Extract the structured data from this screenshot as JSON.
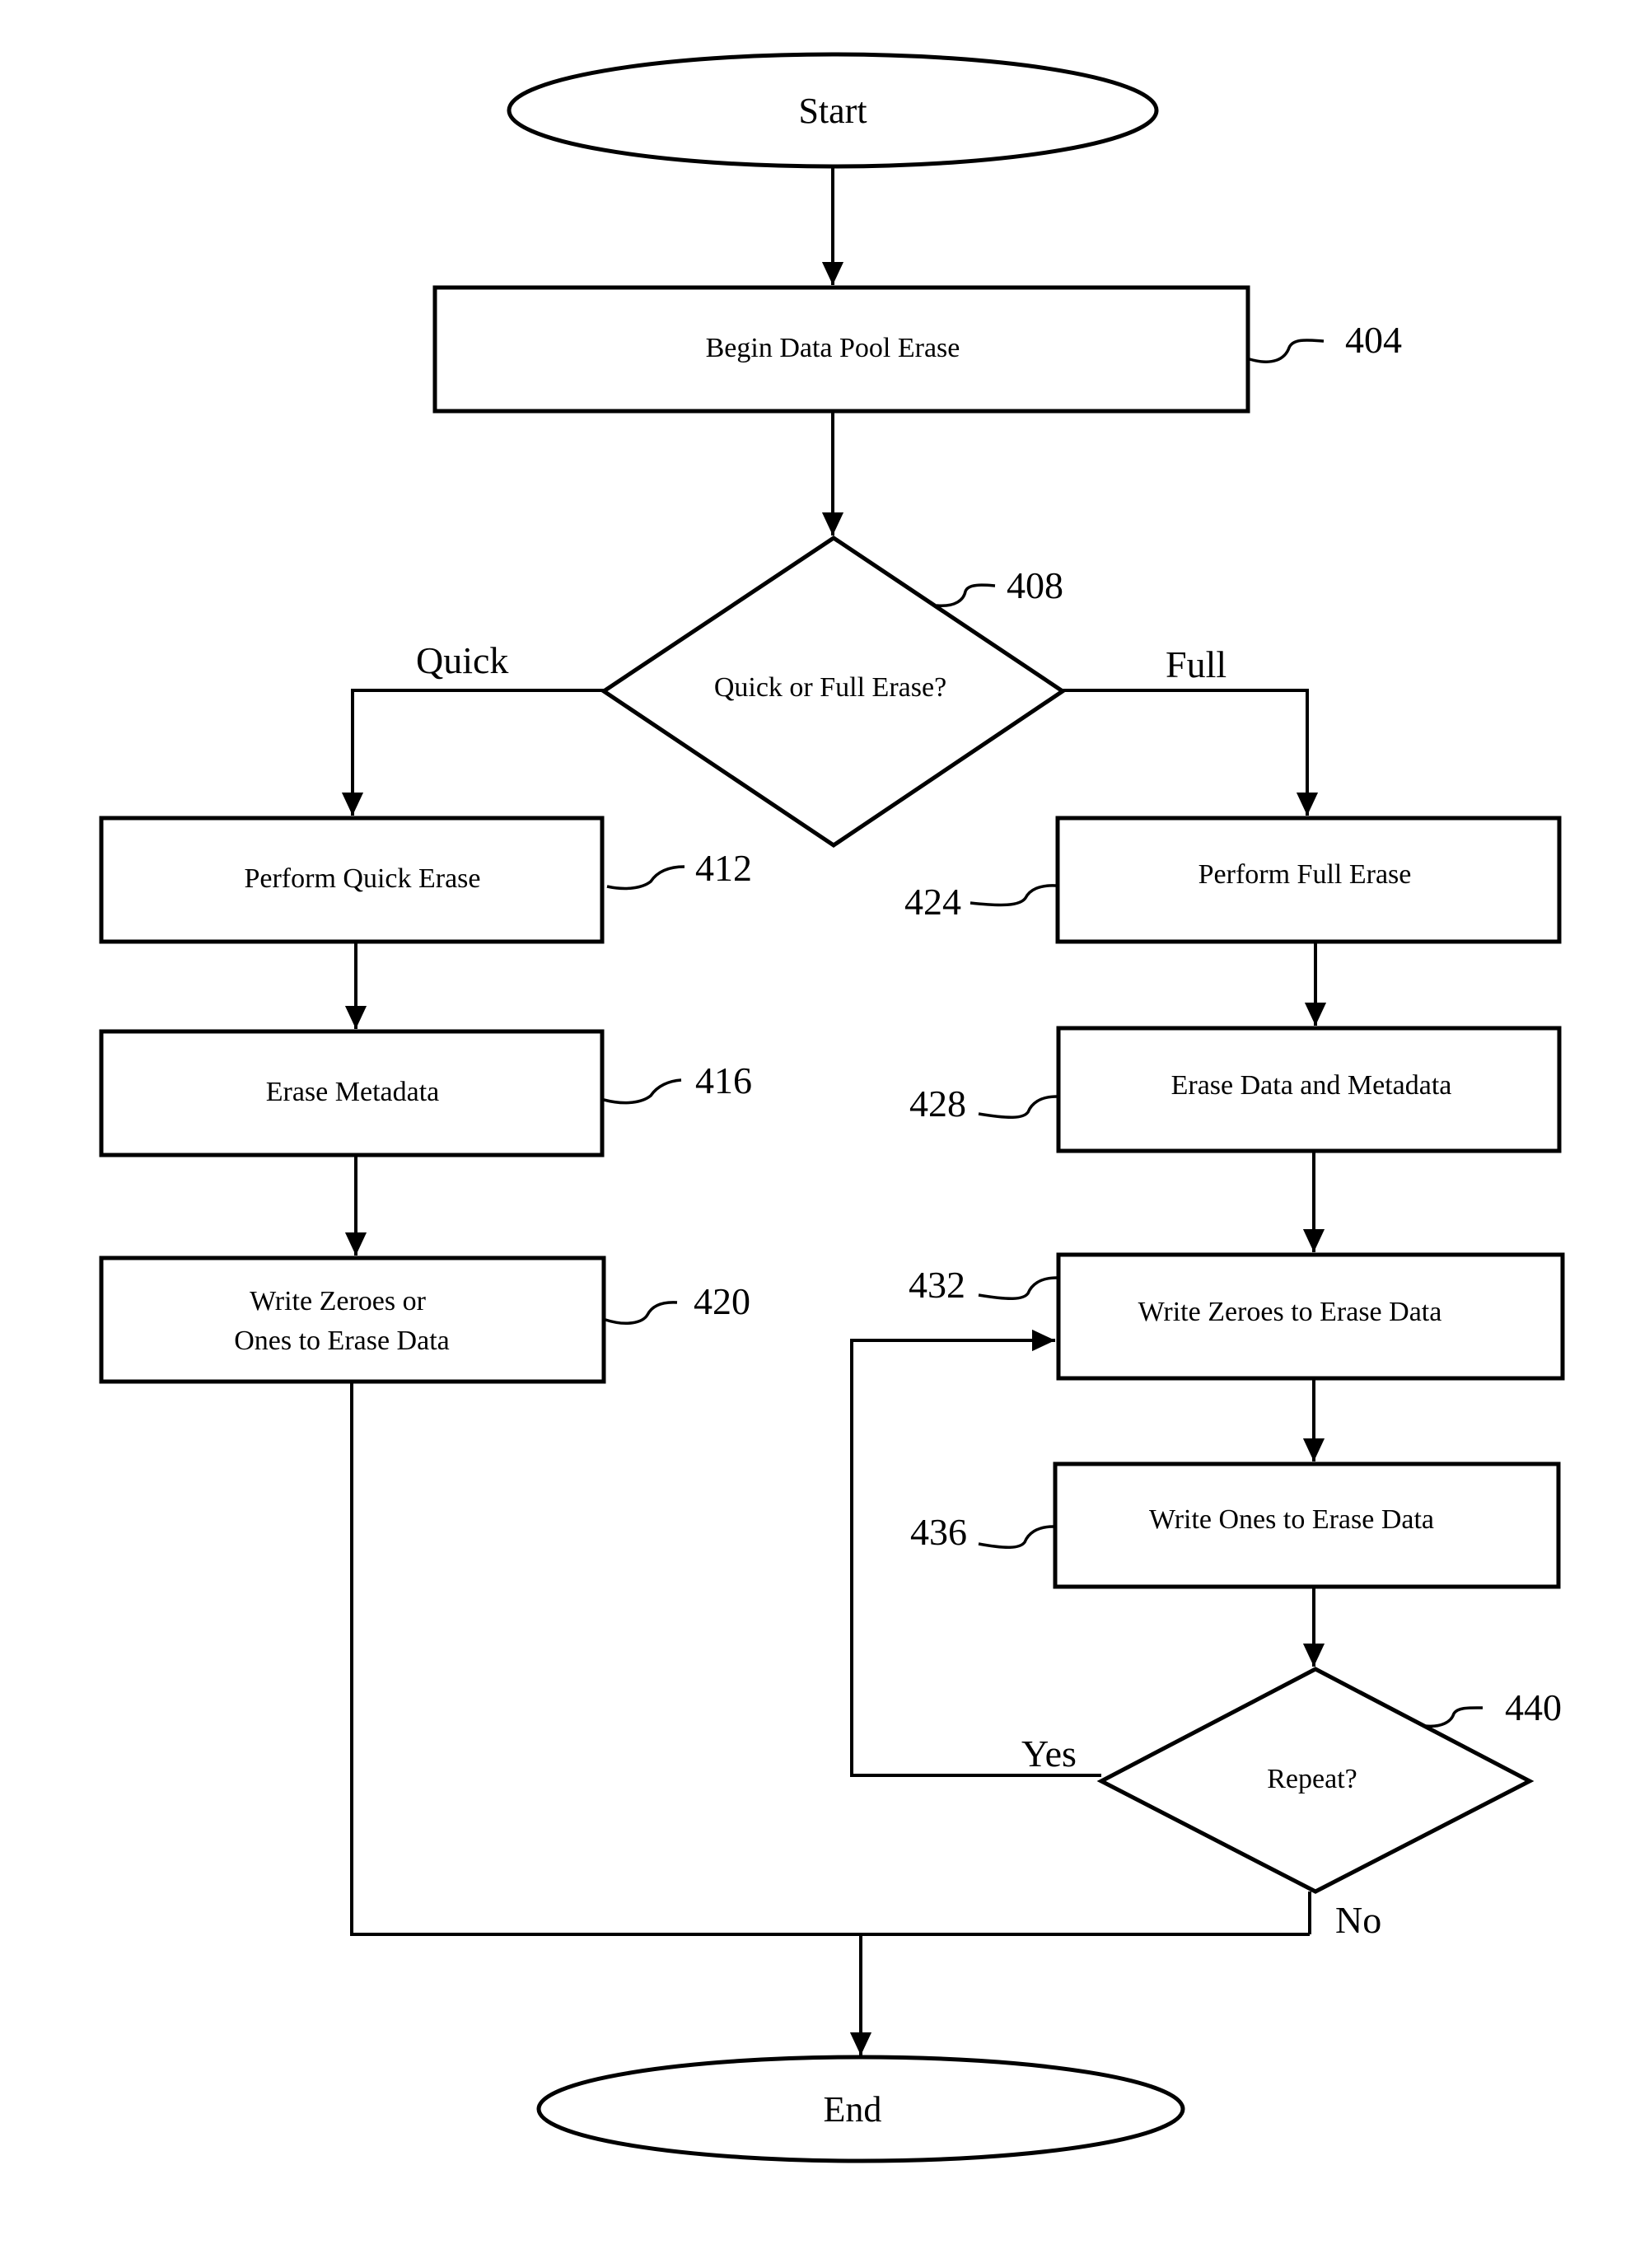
{
  "figure": {
    "type": "flowchart",
    "colors": {
      "line": "#000000",
      "background": "#ffffff",
      "text": "#000000"
    }
  },
  "nodes": {
    "start": {
      "shape": "terminal",
      "label": "Start"
    },
    "n404": {
      "shape": "process",
      "label": "Begin Data Pool Erase",
      "ref": "404"
    },
    "n408": {
      "shape": "decision",
      "label": "Quick or Full Erase?",
      "ref": "408"
    },
    "n412": {
      "shape": "process",
      "label": "Perform Quick Erase",
      "ref": "412"
    },
    "n416": {
      "shape": "process",
      "label": "Erase Metadata",
      "ref": "416"
    },
    "n420": {
      "shape": "process",
      "label_lines": [
        "Write Zeroes or",
        "Ones to Erase Data"
      ],
      "ref": "420"
    },
    "n424": {
      "shape": "process",
      "label": "Perform Full Erase",
      "ref": "424"
    },
    "n428": {
      "shape": "process",
      "label": "Erase Data and Metadata",
      "ref": "428"
    },
    "n432": {
      "shape": "process",
      "label": "Write Zeroes to Erase Data",
      "ref": "432"
    },
    "n436": {
      "shape": "process",
      "label": "Write Ones to Erase Data",
      "ref": "436"
    },
    "n440": {
      "shape": "decision",
      "label": "Repeat?",
      "ref": "440"
    },
    "end": {
      "shape": "terminal",
      "label": "End"
    }
  },
  "branch_labels": {
    "quick": "Quick",
    "full": "Full",
    "yes": "Yes",
    "no": "No"
  },
  "edges": [
    {
      "from": "start",
      "to": "n404"
    },
    {
      "from": "n404",
      "to": "n408"
    },
    {
      "from": "n408",
      "to": "n412",
      "label": "Quick"
    },
    {
      "from": "n408",
      "to": "n424",
      "label": "Full"
    },
    {
      "from": "n412",
      "to": "n416"
    },
    {
      "from": "n416",
      "to": "n420"
    },
    {
      "from": "n420",
      "to": "end"
    },
    {
      "from": "n424",
      "to": "n428"
    },
    {
      "from": "n428",
      "to": "n432"
    },
    {
      "from": "n432",
      "to": "n436"
    },
    {
      "from": "n436",
      "to": "n440"
    },
    {
      "from": "n440",
      "to": "n432",
      "label": "Yes"
    },
    {
      "from": "n440",
      "to": "end",
      "label": "No"
    }
  ]
}
